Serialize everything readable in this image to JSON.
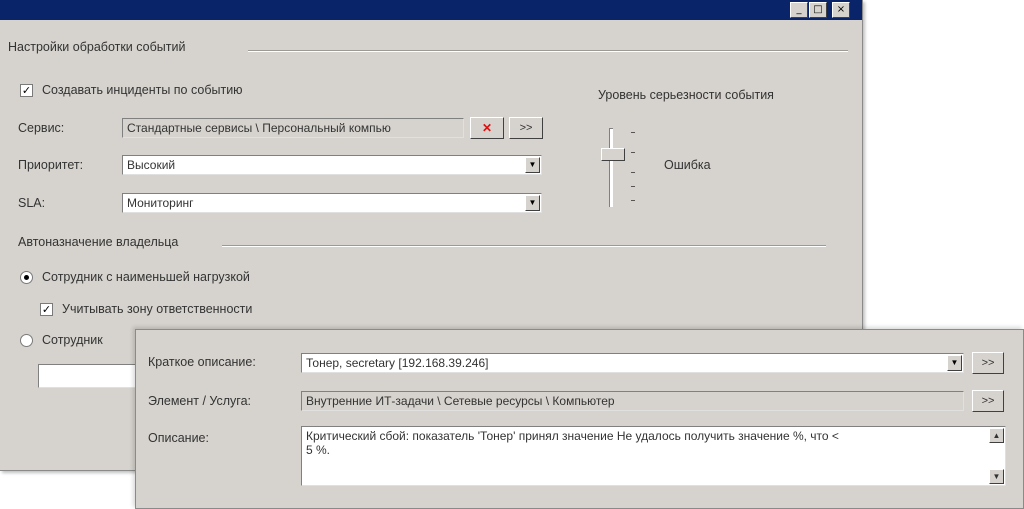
{
  "window": {
    "title_buttons": {
      "minimize": "_",
      "maximize": "□",
      "close": "×"
    },
    "group_event_processing": "Настройки обработки событий",
    "create_incidents_label": "Создавать инциденты по событию",
    "create_incidents_checked": true,
    "service": {
      "label": "Сервис:",
      "value": "Стандартные сервисы \\ Персональный компью"
    },
    "priority": {
      "label": "Приоритет:",
      "value": "Высокий"
    },
    "sla": {
      "label": "SLA:",
      "value": "Мониторинг"
    },
    "severity": {
      "title": "Уровень серьезности события",
      "value_label": "Ошибка",
      "level": "2/5"
    },
    "group_owner": "Автоназначение владельца",
    "radio_least_loaded": "Сотрудник с наименьшей нагрузкой",
    "check_responsibility": "Учитывать зону ответственности",
    "radio_employee": "Сотрудник"
  },
  "dialog": {
    "short_desc": {
      "label": "Краткое описание:",
      "value": "Тонер, secretary [192.168.39.246]"
    },
    "element": {
      "label": "Элемент / Услуга:",
      "value": "Внутренние ИТ-задачи \\ Сетевые ресурсы \\ Компьютер"
    },
    "description": {
      "label": "Описание:",
      "line1": "Критический сбой: показатель 'Тонер' принял значение Не удалось получить значение %, что <",
      "line2": "5 %."
    },
    "browse_label": ">>"
  },
  "icons": {
    "clear": "x-icon",
    "browse": "browse-icon",
    "dropdown": "chevron-down-icon"
  }
}
